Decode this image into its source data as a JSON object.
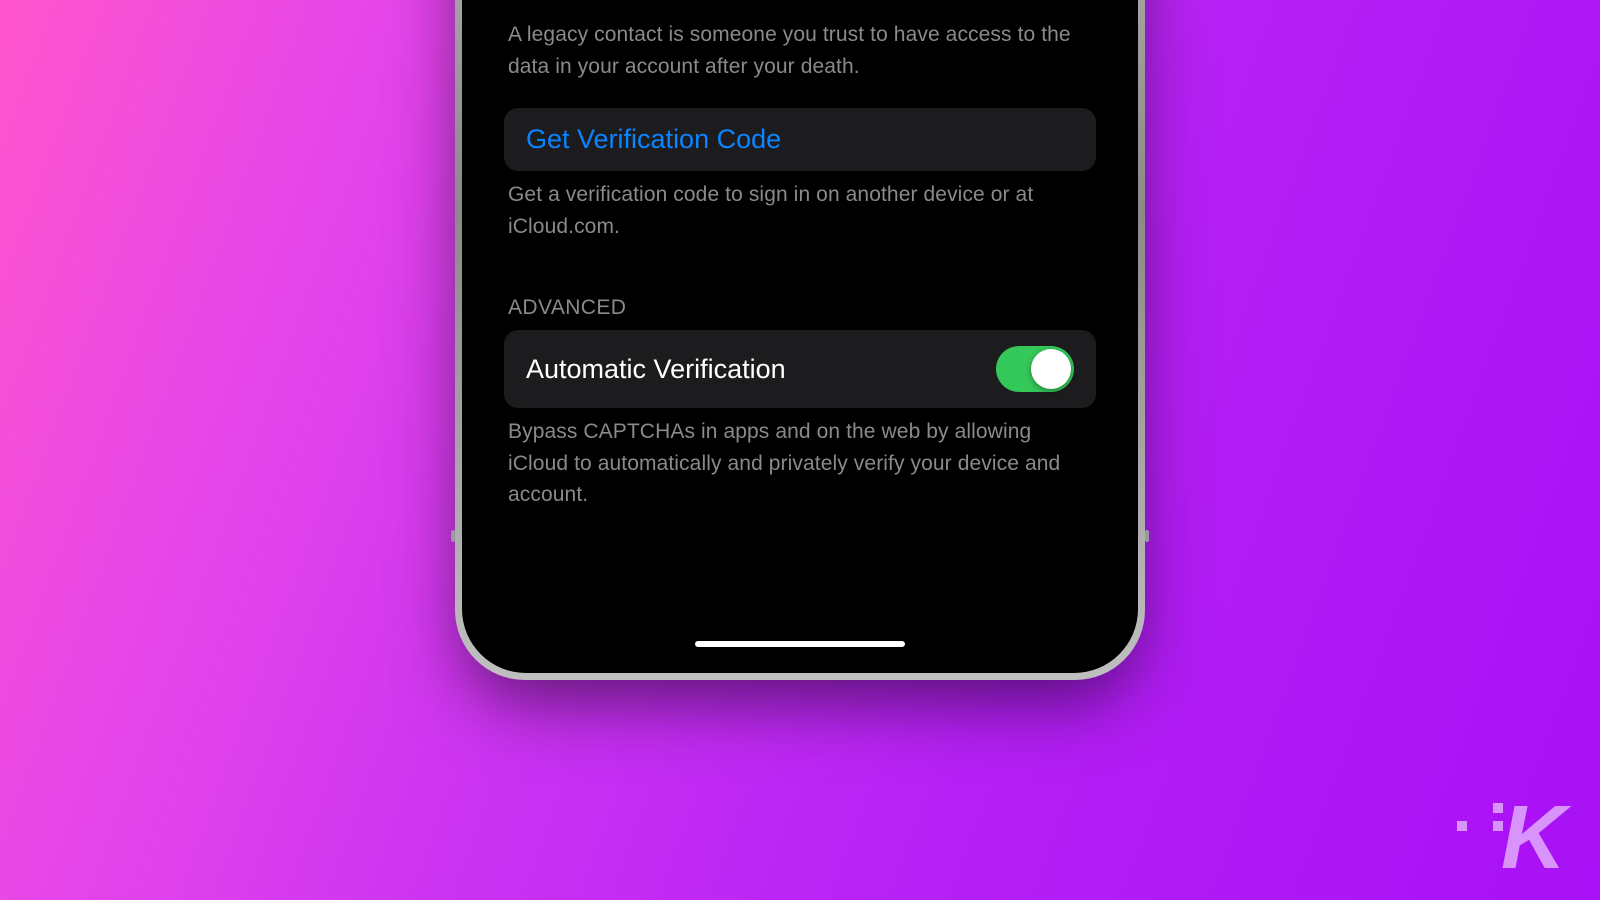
{
  "sections": {
    "legacy": {
      "footer": "A legacy contact is someone you trust to have access to the data in your account after your death."
    },
    "verification": {
      "link_label": "Get Verification Code",
      "footer": "Get a verification code to sign in on another device or at iCloud.com."
    },
    "advanced": {
      "header": "ADVANCED",
      "toggle_label": "Automatic Verification",
      "toggle_on": true,
      "footer": "Bypass CAPTCHAs in apps and on the web by allowing iCloud to automatically and privately verify your device and account."
    }
  },
  "colors": {
    "link": "#0b84ff",
    "toggle_on": "#34c759",
    "cell_bg": "#1c1c1e",
    "secondary_text": "#8a8a8e"
  },
  "watermark": "K"
}
